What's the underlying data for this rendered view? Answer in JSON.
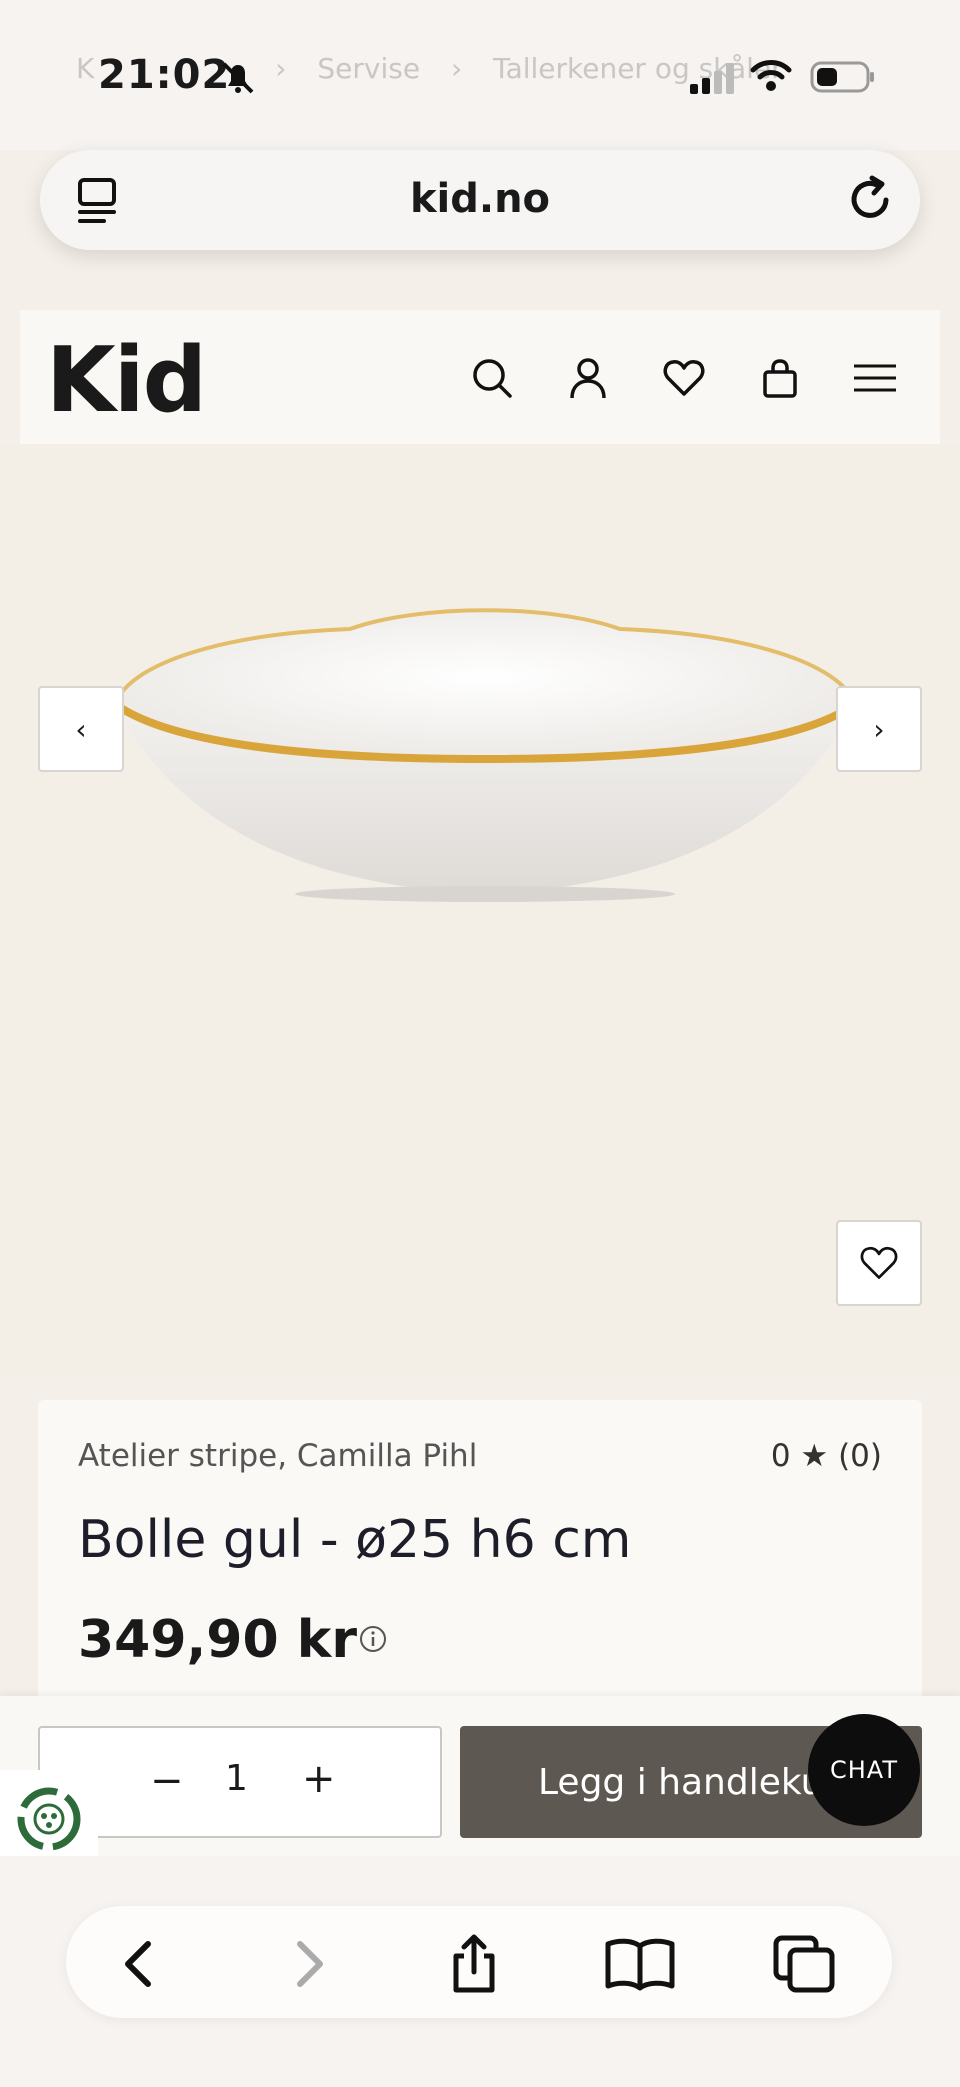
{
  "status_bar": {
    "time": "21:02",
    "breadcrumb": [
      "K",
      "Servise",
      "Tallerkener og skåler"
    ]
  },
  "browser": {
    "url": "kid.no"
  },
  "site": {
    "logo": "Kid",
    "header_icons": [
      "search-icon",
      "user-icon",
      "heart-icon",
      "bag-icon",
      "menu-icon"
    ]
  },
  "gallery": {
    "prev_label": "‹",
    "next_label": "›"
  },
  "product": {
    "brand": "Atelier stripe, Camilla Pihl",
    "rating": "0 ★ (0)",
    "name": "Bolle gul - ø25 h6 cm",
    "price": "349,90 kr"
  },
  "cart": {
    "minus": "−",
    "quantity": "1",
    "plus": "+",
    "add_label": "Legg i handlekurv"
  },
  "chat": {
    "label": "CHAT"
  },
  "colors": {
    "page_bg": "#f4efe8",
    "button_dark": "#5e5852",
    "bowl_rim": "#d9a53a"
  }
}
